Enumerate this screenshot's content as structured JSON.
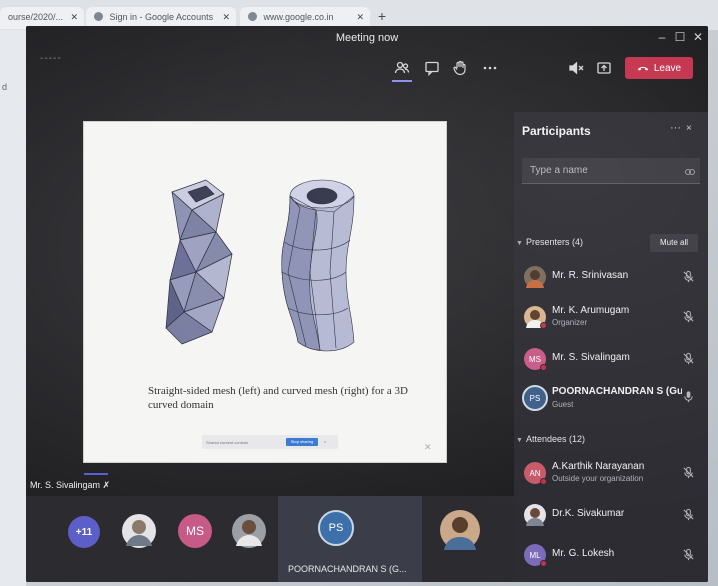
{
  "browser": {
    "tabs": [
      {
        "label": "ourse/2020/..."
      },
      {
        "label": "Sign in - Google Accounts"
      },
      {
        "label": "www.google.co.in"
      }
    ]
  },
  "window": {
    "title": "Meeting now",
    "clock": "-----"
  },
  "toolbar": {
    "leave_label": "Leave",
    "participants_icon": "participants-icon",
    "chat_icon": "chat-icon",
    "raise_hand_icon": "raise-hand-icon",
    "more_icon": "more-icon",
    "mute_speaker_icon": "speaker-mute-icon",
    "share_icon": "share-tray-icon",
    "leave_color": "#c4314b"
  },
  "slide": {
    "caption": "Straight-sided mesh (left) and curved mesh (right) for a 3D curved domain",
    "mini_bar_text": "Shared content controls",
    "mini_bar_button": "Stop sharing",
    "mini_bar_close": "×"
  },
  "presenter": {
    "name": "Mr. S. Sivalingam"
  },
  "gallery": {
    "more_count": "+11",
    "ms_initials": "MS",
    "ps_initials": "PS",
    "ps_name": "POORNACHANDRAN S (G..."
  },
  "participants": {
    "title": "Participants",
    "more": "···",
    "close": "×",
    "search_placeholder": "Type a name",
    "presenters_label": "Presenters (4)",
    "mute_all_label": "Mute all",
    "attendees_label": "Attendees (12)",
    "presenters": [
      {
        "name": "Mr. R. Srinivasan",
        "sub": "",
        "initials": ""
      },
      {
        "name": "Mr. K. Arumugam",
        "sub": "Organizer",
        "initials": ""
      },
      {
        "name": "Mr. S. Sivalingam",
        "sub": "",
        "initials": "MS"
      },
      {
        "name": "POORNACHANDRAN S (Gue...",
        "sub": "Guest",
        "initials": "PS"
      }
    ],
    "attendees": [
      {
        "name": "A.Karthik Narayanan",
        "sub": "Outside your organization",
        "initials": "AN"
      },
      {
        "name": "Dr.K. Sivakumar",
        "sub": "",
        "initials": ""
      },
      {
        "name": "Mr. G. Lokesh",
        "sub": "",
        "initials": "ML"
      }
    ]
  }
}
